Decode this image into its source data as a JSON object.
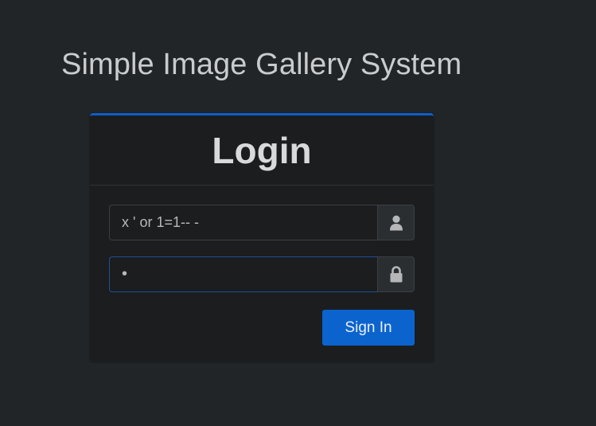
{
  "app": {
    "title": "Simple Image Gallery System"
  },
  "login_card": {
    "title": "Login",
    "username": {
      "value": "x ' or 1=1-- -",
      "icon": "user-icon"
    },
    "password": {
      "value": "•",
      "icon": "lock-icon"
    },
    "submit_label": "Sign In"
  },
  "colors": {
    "background": "#222527",
    "card": "#1b1d1f",
    "accent": "#0b63ce",
    "card_top_border": "#0d5fc9"
  }
}
